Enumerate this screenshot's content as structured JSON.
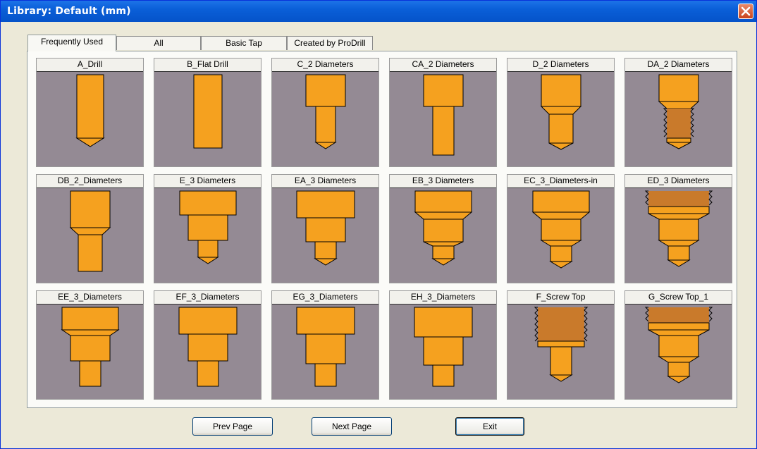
{
  "window": {
    "title": "Library: Default (mm)"
  },
  "tabs": [
    {
      "label": "Frequently Used",
      "active": true
    },
    {
      "label": "All",
      "active": false
    },
    {
      "label": "Basic Tap",
      "active": false
    },
    {
      "label": "Created by ProDrill",
      "active": false
    }
  ],
  "colors": {
    "tool": "#f5a11f",
    "thread": "#c97a2b",
    "background": "#948a94",
    "outline": "#000000"
  },
  "tools": [
    {
      "label": "A_Drill",
      "shape": "drill"
    },
    {
      "label": "B_Flat Drill",
      "shape": "flat"
    },
    {
      "label": "C_2 Diameters",
      "shape": "c2"
    },
    {
      "label": "CA_2 Diameters",
      "shape": "ca2"
    },
    {
      "label": "D_2 Diameters",
      "shape": "d2"
    },
    {
      "label": "DA_2 Diameters",
      "shape": "da2"
    },
    {
      "label": "DB_2_Diameters",
      "shape": "db2"
    },
    {
      "label": "E_3 Diameters",
      "shape": "e3"
    },
    {
      "label": "EA_3 Diameters",
      "shape": "ea3"
    },
    {
      "label": "EB_3 Diameters",
      "shape": "eb3"
    },
    {
      "label": "EC_3_Diameters-in",
      "shape": "ec3"
    },
    {
      "label": "ED_3 Diameters",
      "shape": "ed3"
    },
    {
      "label": "EE_3_Diameters",
      "shape": "ee3"
    },
    {
      "label": "EF_3_Diameters",
      "shape": "ef3"
    },
    {
      "label": "EG_3_Diameters",
      "shape": "eg3"
    },
    {
      "label": "EH_3_Diameters",
      "shape": "eh3"
    },
    {
      "label": "F_Screw Top",
      "shape": "fscrew"
    },
    {
      "label": "G_Screw Top_1",
      "shape": "gscrew"
    }
  ],
  "buttons": {
    "prev": "Prev Page",
    "next": "Next Page",
    "exit": "Exit"
  }
}
